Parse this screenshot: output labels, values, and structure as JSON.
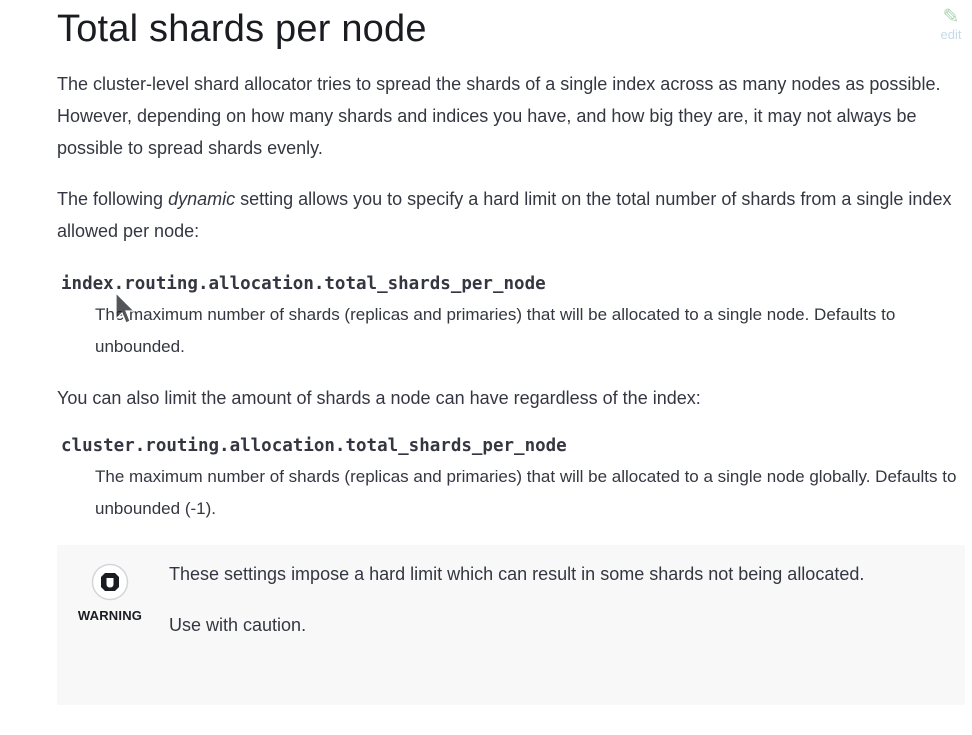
{
  "heading": "Total shards per node",
  "edit": {
    "label": "edit",
    "icon": "pencil-icon"
  },
  "intro_paragraph": "The cluster-level shard allocator tries to spread the shards of a single index across as many nodes as possible. However, depending on how many shards and indices you have, and how big they are, it may not always be possible to spread shards evenly.",
  "dynamic_paragraph": {
    "before": "The following ",
    "emphasis": "dynamic",
    "after": " setting allows you to specify a hard limit on the total number of shards from a single index allowed per node:"
  },
  "settings": [
    {
      "name": "index.routing.allocation.total_shards_per_node",
      "description": "The maximum number of shards (replicas and primaries) that will be allocated to a single node. Defaults to unbounded."
    },
    {
      "name": "cluster.routing.allocation.total_shards_per_node",
      "description": "The maximum number of shards (replicas and primaries) that will be allocated to a single node globally. Defaults to unbounded (-1)."
    }
  ],
  "regardless_paragraph": "You can also limit the amount of shards a node can have regardless of the index:",
  "warning": {
    "label": "WARNING",
    "icon": "warning-hand-icon",
    "text": "These settings impose a hard limit which can result in some shards not being allocated.",
    "caution": "Use with caution."
  },
  "colors": {
    "text": "#343741",
    "heading": "#1a1c21",
    "admonition_bg": "#f7f8f7",
    "edit": "#c6dbe8"
  }
}
